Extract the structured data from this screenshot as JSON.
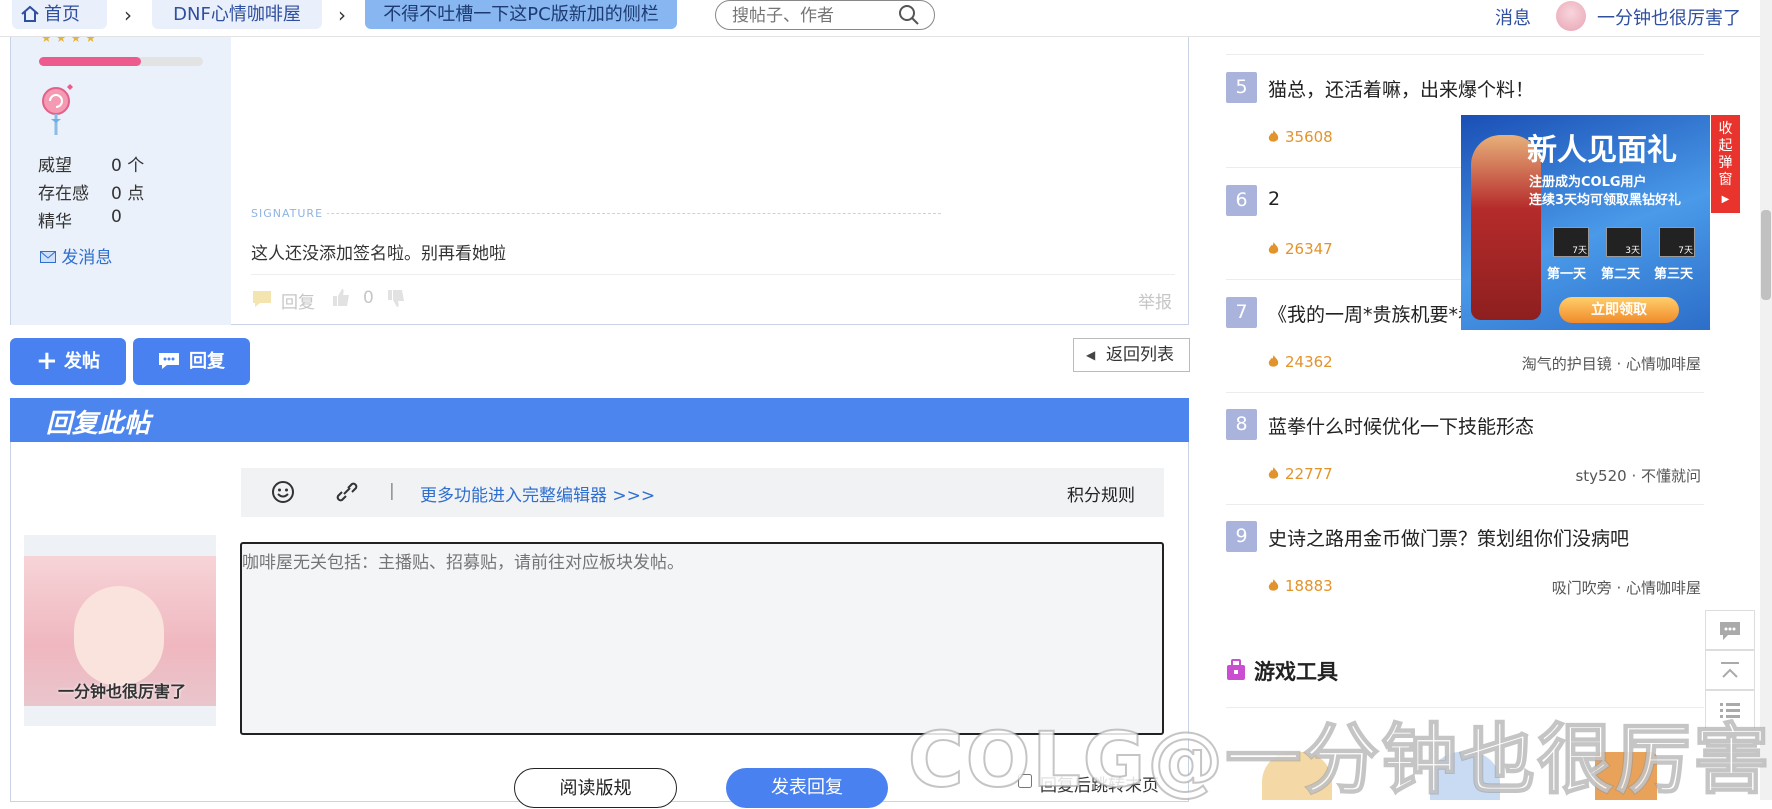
{
  "nav": {
    "home": "首页",
    "forum": "DNF心情咖啡屋",
    "thread": "不得不吐槽一下这PC版新加的侧栏",
    "search_placeholder": "搜帖子、作者",
    "messages": "消息",
    "username": "一分钟也很厉害了"
  },
  "author": {
    "stats": [
      {
        "label": "威望",
        "value": "0 个"
      },
      {
        "label": "存在感",
        "value": "0 点"
      },
      {
        "label": "精华",
        "value": "0"
      }
    ],
    "send_message": "发消息",
    "exp_progress": 0.62
  },
  "post": {
    "signature_label": "SIGNATURE",
    "signature_text": "这人还没添加签名啦。别再看她啦",
    "reply": "回复",
    "likes": "0",
    "report": "举报"
  },
  "actions": {
    "new_post": "发帖",
    "reply": "回复",
    "back_to_list": "返回列表"
  },
  "reply_form": {
    "title": "回复此帖",
    "more_editor": "更多功能进入完整编辑器 >>>",
    "points_rules": "积分规则",
    "placeholder": "咖啡屋无关包括：主播贴、招募贴，请前往对应板块发帖。",
    "avatar_caption": "一分钟也很厉害了",
    "read_rules": "阅读版规",
    "submit": "发表回复",
    "jump_label": "回复后跳转末页"
  },
  "hot_list": [
    {
      "rank": "5",
      "title": "猫总，还活着嘛，出来爆个料！",
      "heat": "35608",
      "meta": ""
    },
    {
      "rank": "6",
      "title": "2",
      "heat": "26347",
      "meta": ""
    },
    {
      "rank": "7",
      "title": "《我的一周*贵族机要*看",
      "heat": "24362",
      "meta": "淘气的护目镜 · 心情咖啡屋"
    },
    {
      "rank": "8",
      "title": "蓝拳什么时候优化一下技能形态",
      "heat": "22777",
      "meta": "sty520 · 不懂就问"
    },
    {
      "rank": "9",
      "title": "史诗之路用金币做门票？策划组你们没病吧",
      "heat": "18883",
      "meta": "吸门吹旁 · 心情咖啡屋"
    }
  ],
  "tools_section": {
    "title": "游戏工具"
  },
  "ad": {
    "close_label": "收起弹窗",
    "headline": "新人见面礼",
    "sub1": "注册成为COLG用户",
    "sub2": "连续3天均可领取黑钻好礼",
    "days": [
      "第一天",
      "第二天",
      "第三天"
    ],
    "day_badges": [
      "7天",
      "3天",
      "7天"
    ],
    "cta": "立即领取"
  },
  "watermark": "COLG@一分钟也很厉害了",
  "colors": {
    "accent": "#4a81f0",
    "header_blue": "#4d85ee",
    "rank_badge": "#a9b3dc",
    "heat": "#e3932b"
  }
}
